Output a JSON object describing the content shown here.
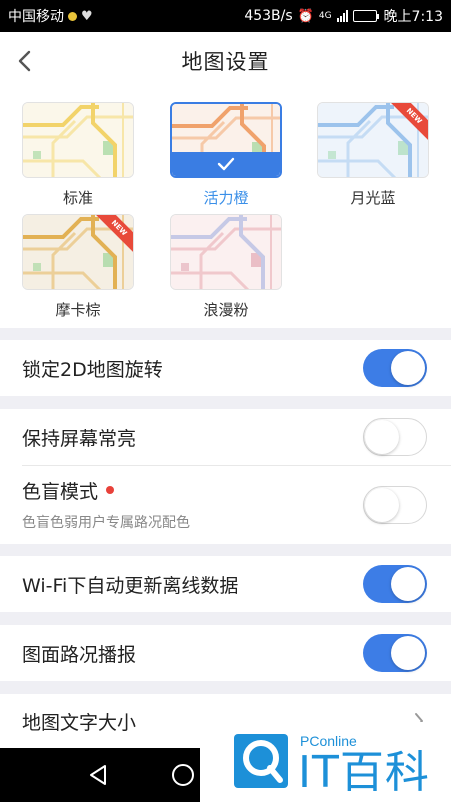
{
  "status_bar": {
    "carrier": "中国移动",
    "speed": "453B/s",
    "network": "4G",
    "battery": "73",
    "time": "晚上7:13"
  },
  "header": {
    "title": "地图设置"
  },
  "themes": [
    {
      "label": "标准",
      "selected": false,
      "is_new": false
    },
    {
      "label": "活力橙",
      "selected": true,
      "is_new": false
    },
    {
      "label": "月光蓝",
      "selected": false,
      "is_new": true
    },
    {
      "label": "摩卡棕",
      "selected": false,
      "is_new": true
    },
    {
      "label": "浪漫粉",
      "selected": false,
      "is_new": false
    }
  ],
  "new_badge": "NEW",
  "settings": {
    "lock_2d": {
      "label": "锁定2D地图旋转",
      "on": true
    },
    "keep_screen_on": {
      "label": "保持屏幕常亮",
      "on": false
    },
    "color_blind": {
      "label": "色盲模式",
      "subtitle": "色盲色弱用户专属路况配色",
      "on": false
    },
    "wifi_offline": {
      "label": "Wi-Fi下自动更新离线数据",
      "on": true
    },
    "traffic_broadcast": {
      "label": "图面路况播报",
      "on": true
    },
    "text_size": {
      "label": "地图文字大小"
    }
  },
  "watermark": {
    "brand_small": "PConline",
    "brand_large": "IT百科"
  },
  "colors": {
    "accent": "#3d7de6",
    "selected_label": "#3a8fe8",
    "new_badge": "#e84a3a"
  }
}
